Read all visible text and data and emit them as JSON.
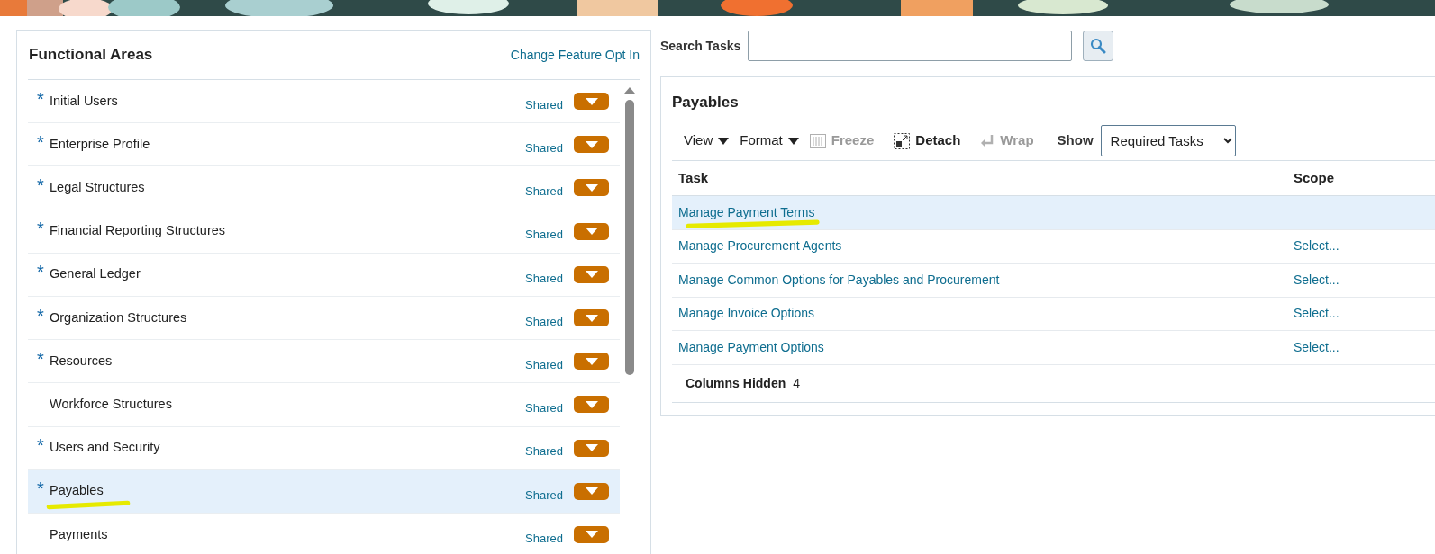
{
  "functional_areas": {
    "title": "Functional Areas",
    "link": "Change Feature Opt In",
    "items": [
      {
        "marker": "*",
        "label": "Initial Users",
        "selected": false,
        "highlighted": false,
        "status": "Shared"
      },
      {
        "marker": "*",
        "label": "Enterprise Profile",
        "selected": false,
        "highlighted": false,
        "status": "Shared"
      },
      {
        "marker": "*",
        "label": "Legal Structures",
        "selected": false,
        "highlighted": false,
        "status": "Shared"
      },
      {
        "marker": "*",
        "label": "Financial Reporting Structures",
        "selected": false,
        "highlighted": false,
        "status": "Shared"
      },
      {
        "marker": "*",
        "label": "General Ledger",
        "selected": false,
        "highlighted": false,
        "status": "Shared"
      },
      {
        "marker": "*",
        "label": "Organization Structures",
        "selected": false,
        "highlighted": false,
        "status": "Shared"
      },
      {
        "marker": "*",
        "label": "Resources",
        "selected": false,
        "highlighted": false,
        "status": "Shared"
      },
      {
        "label": "Workforce Structures",
        "selected": false,
        "highlighted": false,
        "status": "Shared"
      },
      {
        "marker": "*",
        "label": "Users and Security",
        "selected": false,
        "highlighted": false,
        "status": "Shared"
      },
      {
        "marker": "*",
        "label": "Payables",
        "selected": true,
        "highlighted": true,
        "status": "Shared"
      },
      {
        "label": "Payments",
        "selected": false,
        "highlighted": false,
        "status": "Shared"
      }
    ]
  },
  "search": {
    "label": "Search Tasks"
  },
  "tasks_panel": {
    "title": "Payables",
    "toolbar": [
      {
        "kind": "menu",
        "label": "View",
        "disabled": false
      },
      {
        "kind": "menu",
        "label": "Format",
        "disabled": false
      },
      {
        "kind": "freeze",
        "label": "Freeze",
        "disabled": true
      },
      {
        "kind": "detach",
        "label": "Detach",
        "disabled": false
      },
      {
        "kind": "wrap",
        "label": "Wrap",
        "disabled": true
      }
    ],
    "show_label": "Show",
    "show_value": "Required Tasks",
    "columns": [
      "Task",
      "Scope"
    ],
    "rows": [
      {
        "task": "Manage Payment Terms",
        "selected": true,
        "highlighted": true
      },
      {
        "task": "Manage Procurement Agents",
        "scope": "Select...",
        "selected": false,
        "highlighted": false
      },
      {
        "task": "Manage Common Options for Payables and Procurement",
        "scope": "Select...",
        "selected": false,
        "highlighted": false
      },
      {
        "task": "Manage Invoice Options",
        "scope": "Select...",
        "selected": false,
        "highlighted": false
      },
      {
        "task": "Manage Payment Options",
        "scope": "Select...",
        "selected": false,
        "highlighted": false
      }
    ],
    "footer_label": "Columns Hidden",
    "footer_value": "4"
  }
}
